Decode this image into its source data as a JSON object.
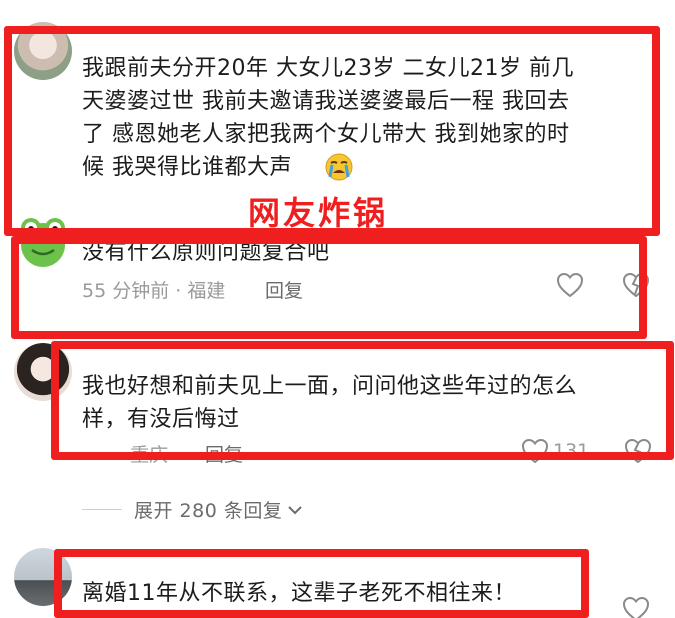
{
  "overlay": {
    "label": "网友炸锅"
  },
  "comments": [
    {
      "text": [
        "我跟前夫分开20年  大女儿23岁   二女儿21岁   前几",
        "天婆婆过世  我前夫邀请我送婆婆最后一程  我回去",
        "了  感恩她老人家把我两个女儿带大  我到她家的时",
        "候  我哭得比谁都大声"
      ],
      "emoji": "crying-face"
    },
    {
      "text": [
        "没有什么原则问题复合吧"
      ],
      "meta": "55 分钟前 · 福建",
      "reply": "回复"
    },
    {
      "text": [
        "我也好想和前夫见上一面，问问他这些年过的怎么",
        "样，有没后悔过"
      ],
      "meta": "· 重庆",
      "reply": "回复",
      "likes": "131"
    },
    {
      "text": [
        "离婚11年从不联系，这辈子老死不相往来！"
      ]
    }
  ],
  "expand": {
    "label": "展开 280 条回复"
  },
  "colors": {
    "highlight": "#f01f1f",
    "meta": "#9a9a9a"
  }
}
